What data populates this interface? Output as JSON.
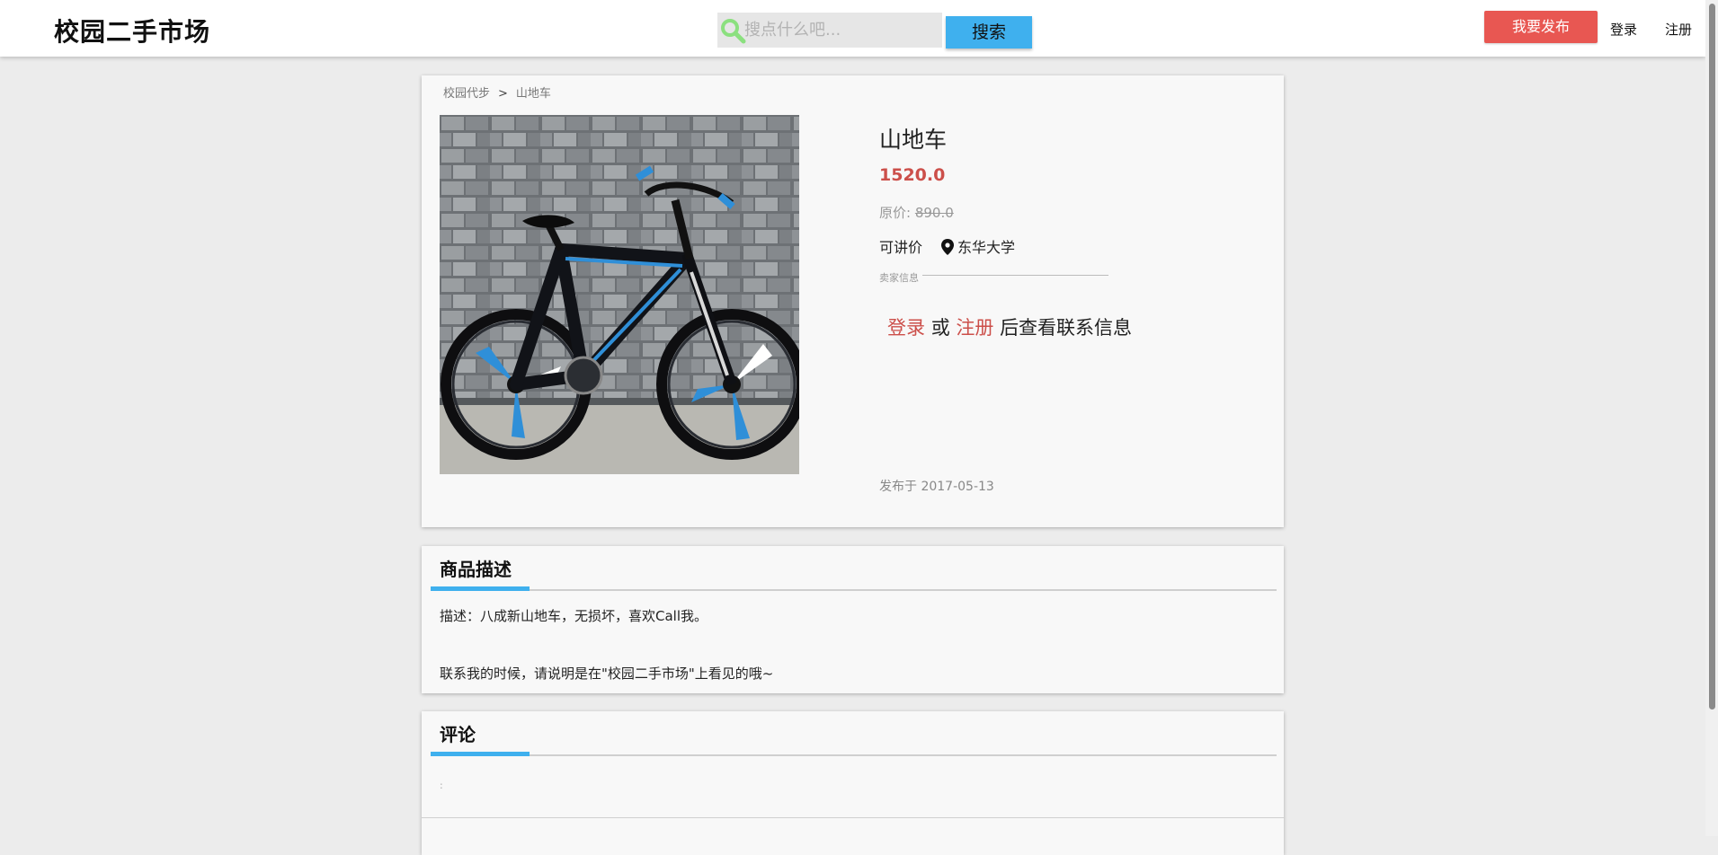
{
  "header": {
    "logo": "校园二手市场",
    "search_placeholder": "搜点什么吧...",
    "search_button": "搜索",
    "publish_button": "我要发布",
    "login": "登录",
    "register": "注册"
  },
  "breadcrumb": {
    "category": "校园代步",
    "separator": ">",
    "current": "山地车"
  },
  "product": {
    "title": "山地车",
    "price": "1520.0",
    "original_price_label": "原价:",
    "original_price": "890.0",
    "negotiable": "可讲价",
    "location": "东华大学",
    "seller_info_label": "卖家信息",
    "login_link": "登录",
    "or_text": "或",
    "register_link": "注册",
    "contact_suffix": "后查看联系信息",
    "publish_date": "发布于 2017-05-13",
    "image_icon": "bicycle-photo"
  },
  "description": {
    "title": "商品描述",
    "text": "描述：八成新山地车，无损坏，喜欢Call我。",
    "contact_note": "联系我的时候，请说明是在\"校园二手市场\"上看见的哦~"
  },
  "comments": {
    "title": "评论",
    "placeholder_mark": ":"
  },
  "colors": {
    "accent_blue": "#3fb0ee",
    "accent_red": "#e85752",
    "price_red": "#cc4f4a"
  }
}
